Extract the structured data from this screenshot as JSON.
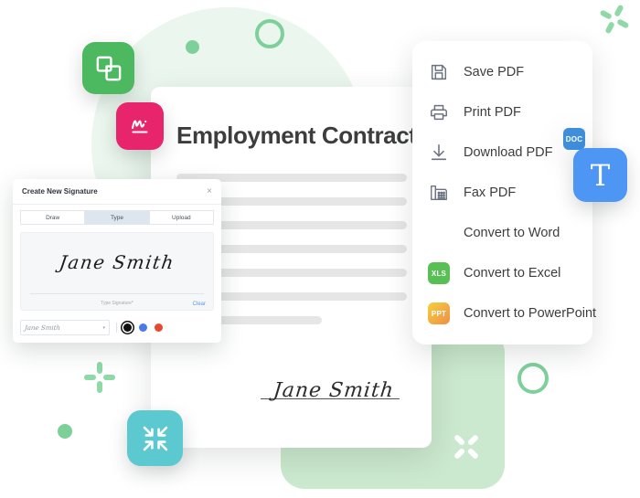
{
  "document": {
    "title": "Employment Contract",
    "signature": "Jane Smith",
    "body_lines": [
      "",
      "",
      "",
      "",
      "",
      "",
      ""
    ]
  },
  "action_menu": {
    "items": [
      {
        "label": "Save PDF",
        "icon": "floppy-disk-icon",
        "type": "line"
      },
      {
        "label": "Print PDF",
        "icon": "printer-icon",
        "type": "line"
      },
      {
        "label": "Download PDF",
        "icon": "download-icon",
        "type": "line"
      },
      {
        "label": "Fax PDF",
        "icon": "fax-machine-icon",
        "type": "line"
      },
      {
        "label": "Convert to Word",
        "icon": "doc-badge-icon",
        "type": "badge",
        "badge": "DOC",
        "color": "#3f8edc"
      },
      {
        "label": "Convert to Excel",
        "icon": "xls-badge-icon",
        "type": "badge",
        "badge": "XLS",
        "color": "#58bf54"
      },
      {
        "label": "Convert to PowerPoint",
        "icon": "ppt-badge-icon",
        "type": "badge",
        "badge": "PPT",
        "color": "#ef8f45"
      }
    ]
  },
  "signature_dialog": {
    "title": "Create New Signature",
    "close_label": "×",
    "tabs": [
      {
        "label": "Draw",
        "active": false
      },
      {
        "label": "Type",
        "active": true
      },
      {
        "label": "Upload",
        "active": false
      }
    ],
    "signature_value": "Jane Smith",
    "placeholder": "Type Signature*",
    "clear_label": "Clear",
    "font_select_value": "Jane Smith",
    "caret": "▾",
    "colors": [
      {
        "name": "black",
        "hex": "#111111",
        "selected": true
      },
      {
        "name": "blue",
        "hex": "#4a7ce8",
        "selected": false
      },
      {
        "name": "red",
        "hex": "#e8482d",
        "selected": false
      }
    ]
  },
  "floating_tiles": [
    {
      "name": "merge-pdf-tile",
      "color": "#4cb860",
      "icon": "merge-squares-icon"
    },
    {
      "name": "sign-pdf-tile",
      "color": "#e8246c",
      "icon": "signature-icon"
    },
    {
      "name": "text-tool-tile",
      "color": "#4e96f3",
      "icon": "text-t-icon",
      "glyph": "T"
    },
    {
      "name": "compress-pdf-tile",
      "color": "#5cc8cf",
      "icon": "compress-arrows-icon"
    }
  ],
  "decor": {
    "circle_bg": "#eaf6ee",
    "rect_bg": "#cbe9ce",
    "accent_green": "#7ed09b",
    "sparkle_green": "#8ed9a6"
  }
}
